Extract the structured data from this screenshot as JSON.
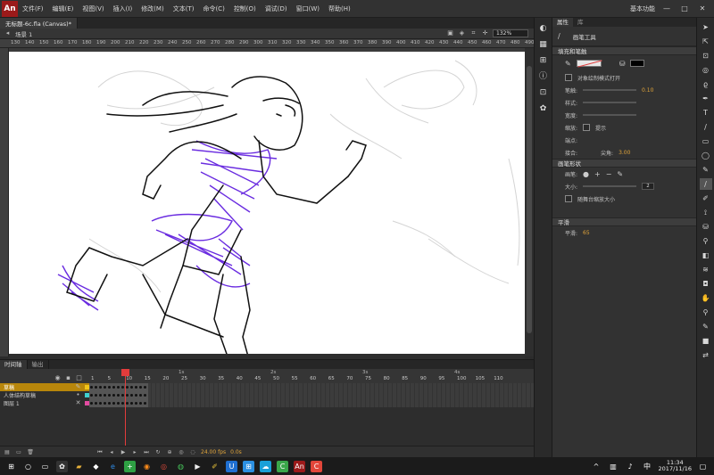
{
  "app": {
    "logo": "An"
  },
  "menu": {
    "items": [
      "文件(F)",
      "编辑(E)",
      "视图(V)",
      "插入(I)",
      "修改(M)",
      "文本(T)",
      "命令(C)",
      "控制(O)",
      "调试(D)",
      "窗口(W)",
      "帮助(H)"
    ],
    "workspace": "基本功能",
    "minimize": "—",
    "maximize": "□",
    "close": "✕"
  },
  "document": {
    "tab_title": "无标题-6c.fla (Canvas)*",
    "scene": "场景 1",
    "zoom": "132%"
  },
  "ruler": {
    "ticks": [
      "130",
      "140",
      "150",
      "160",
      "170",
      "180",
      "190",
      "200",
      "210",
      "220",
      "230",
      "240",
      "250",
      "260",
      "270",
      "280",
      "290",
      "300",
      "310",
      "320",
      "330",
      "340",
      "350",
      "360",
      "370",
      "380",
      "390",
      "400",
      "410",
      "420",
      "430",
      "440",
      "450",
      "460",
      "470",
      "480",
      "490"
    ]
  },
  "timeline": {
    "tabs": [
      "时间轴",
      "输出"
    ],
    "seconds": [
      "1s",
      "2s",
      "3s",
      "4s"
    ],
    "frame_numbers": [
      "1",
      "5",
      "10",
      "15",
      "20",
      "25",
      "30",
      "35",
      "40",
      "45",
      "50",
      "55",
      "60",
      "65",
      "70",
      "75",
      "80",
      "85",
      "90",
      "95",
      "100",
      "105",
      "110"
    ],
    "layers": [
      {
        "name": "草稿",
        "color": "#f0c419"
      },
      {
        "name": "人体结构草稿",
        "color": "#3fd0d0"
      },
      {
        "name": "图层 1",
        "color": "#e24ba0"
      }
    ],
    "fps": "24.00 fps",
    "time": "0.0s"
  },
  "properties": {
    "tabs": [
      "属性",
      "库"
    ],
    "tool_name": "画笔工具",
    "sections": {
      "fill_stroke": "填充和笔触",
      "brush_shape": "画笔形状",
      "smoothing": "平滑"
    },
    "draw_object_label": "对象绘制模式打开",
    "stroke_label": "笔触:",
    "stroke_value": "0.10",
    "style_label": "样式:",
    "width_label": "宽度:",
    "scale_label": "缩放:",
    "hint_label": "提示",
    "end_label": "端点:",
    "join_label": "接合:",
    "miter_label": "尖角:",
    "miter_value": "3.00",
    "shape_label": "画笔:",
    "size_label": "大小:",
    "size_value": "2",
    "scale_with_stage": "随舞台缩放大小",
    "smoothing_label": "平滑:",
    "smoothing_value": "65"
  },
  "taskbar": {
    "time": "11:34",
    "date": "2017/11/16",
    "lang": "中"
  },
  "colors": {
    "accent_red": "#e23c3c",
    "sketch_purple": "#6a2ce0"
  }
}
